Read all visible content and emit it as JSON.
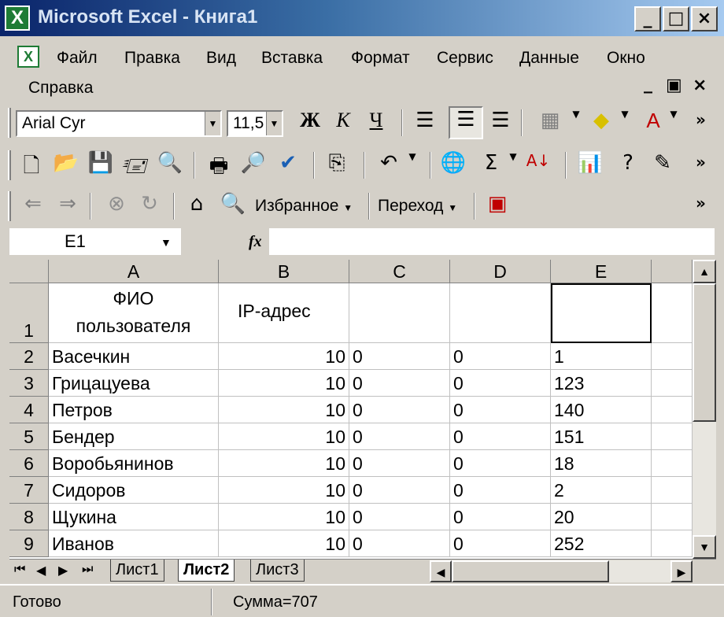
{
  "window": {
    "title": "Microsoft Excel - Книга1",
    "app_icon": "X",
    "minimize": "_",
    "maximize": "□",
    "close": "×"
  },
  "menu": {
    "items": [
      "Файл",
      "Правка",
      "Вид",
      "Вставка",
      "Формат",
      "Сервис",
      "Данные",
      "Окно",
      "Справка"
    ],
    "mdi": {
      "minimize": "_",
      "restore": "▣",
      "close": "×"
    }
  },
  "formatting": {
    "font_name": "Arial Cyr",
    "font_size": "11,5",
    "bold": "Ж",
    "italic": "К",
    "underline": "Ч"
  },
  "web": {
    "favorites_label": "Избранное",
    "goto_label": "Переход"
  },
  "formula": {
    "name_box": "E1",
    "fx": "fx",
    "value": ""
  },
  "sheet": {
    "columns": [
      "A",
      "B",
      "C",
      "D",
      "E"
    ],
    "row_numbers": [
      "1",
      "2",
      "3",
      "4",
      "5",
      "6",
      "7",
      "8",
      "9"
    ],
    "header_row": {
      "a_line1": "ФИО",
      "a_line2": "пользователя",
      "b": "IP-адрес",
      "c": "",
      "d": "",
      "e": ""
    },
    "rows": [
      {
        "name": "Васечкин",
        "b": "10",
        "c": "0",
        "d": "0",
        "e": "1"
      },
      {
        "name": "Грицацуева",
        "b": "10",
        "c": "0",
        "d": "0",
        "e": "123"
      },
      {
        "name": "Петров",
        "b": "10",
        "c": "0",
        "d": "0",
        "e": "140"
      },
      {
        "name": "Бендер",
        "b": "10",
        "c": "0",
        "d": "0",
        "e": "151"
      },
      {
        "name": "Воробьянинов",
        "b": "10",
        "c": "0",
        "d": "0",
        "e": "18"
      },
      {
        "name": "Сидоров",
        "b": "10",
        "c": "0",
        "d": "0",
        "e": "2"
      },
      {
        "name": "Щукина",
        "b": "10",
        "c": "0",
        "d": "0",
        "e": "20"
      },
      {
        "name": "Иванов",
        "b": "10",
        "c": "0",
        "d": "0",
        "e": "252"
      }
    ]
  },
  "tabs": [
    "Лист1",
    "Лист2",
    "Лист3"
  ],
  "active_tab": "Лист2",
  "status": {
    "ready": "Готово",
    "sum": "Сумма=707"
  }
}
